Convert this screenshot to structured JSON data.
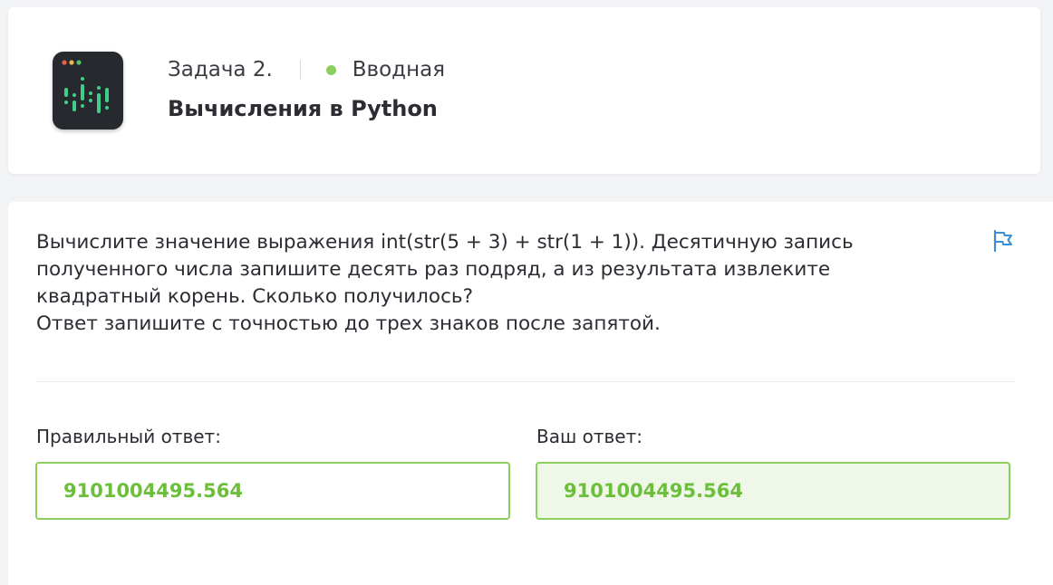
{
  "header": {
    "task_label": "Задача 2.",
    "difficulty": "Вводная",
    "title": "Вычисления в Python",
    "icon": "python-terminal-icon"
  },
  "question": {
    "lines": [
      "Вычислите значение выражения int(str(5 + 3) + str(1 + 1)). Десятичную запись",
      "полученного числа запишите десять раз подряд, а из результата извлеките",
      "квадратный корень. Сколько получилось?",
      "Ответ запишите с точностью до трех знаков после запятой."
    ],
    "flag_icon": "flag-icon"
  },
  "answers": {
    "correct_label": "Правильный ответ:",
    "correct_value": "9101004495.564",
    "user_label": "Ваш ответ:",
    "user_value": "9101004495.564"
  },
  "colors": {
    "accent_green": "#8ccf5c",
    "answer_text": "#6cbf3a",
    "user_answer_bg": "#eff8e8",
    "flag_blue": "#3b8fd6"
  }
}
